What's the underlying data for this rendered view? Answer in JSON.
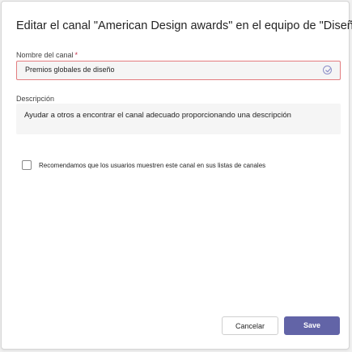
{
  "dialog": {
    "title": "Editar el canal \"American Design awards\" en el equipo de \"Diseño\""
  },
  "name_field": {
    "label": "Nombre del canal",
    "required_mark": "*",
    "value": "Premios globales de diseño",
    "status_icon": "check-circle-icon"
  },
  "description_field": {
    "label": "Descripción",
    "value": "Ayudar a otros a encontrar el canal adecuado proporcionando una descripción"
  },
  "recommend": {
    "label": "Recomendamos que los usuarios muestren este canal en sus listas de canales",
    "checked": false
  },
  "actions": {
    "cancel_label": "Cancelar",
    "save_label": "Save"
  },
  "colors": {
    "accent": "#6264a7",
    "error_border": "#e37d80",
    "input_bg": "#f5f5f5"
  }
}
